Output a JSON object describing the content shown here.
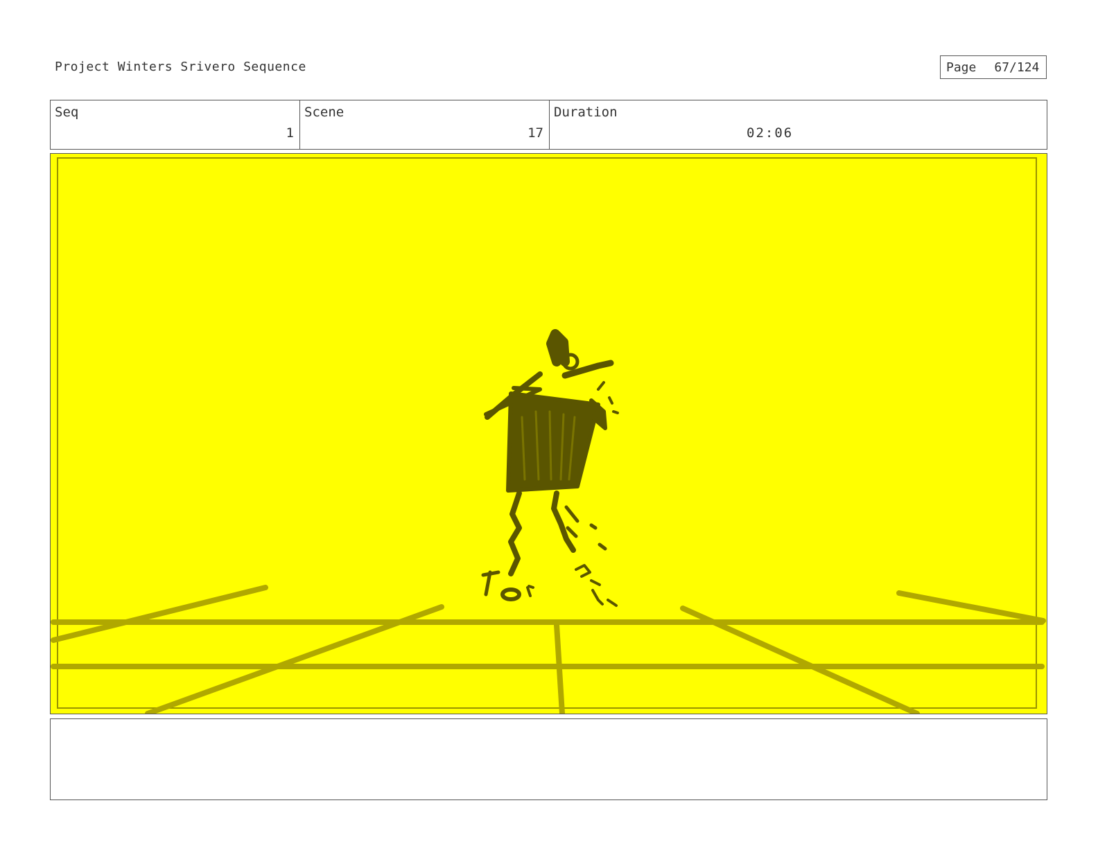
{
  "header": {
    "project_title": "Project Winters Srivero Sequence",
    "page_label": "Page",
    "page_number": "67/124"
  },
  "info": {
    "seq_label": "Seq",
    "seq_value": "1",
    "scene_label": "Scene",
    "scene_value": "17",
    "duration_label": "Duration",
    "duration_value": "02:06"
  },
  "panel": {
    "background_color": "#ffff00",
    "sketch_color": "#5a5500",
    "grid_color": "#b0a800"
  },
  "notes": {
    "text": ""
  }
}
